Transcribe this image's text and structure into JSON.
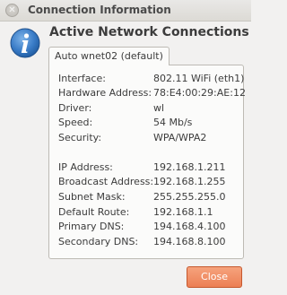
{
  "window": {
    "title": "Connection Information"
  },
  "heading": "Active Network Connections",
  "tab": {
    "label": "Auto wnet02 (default)"
  },
  "details": {
    "interface": {
      "label": "Interface:",
      "value": "802.11 WiFi (eth1)"
    },
    "hardware_address": {
      "label": "Hardware Address:",
      "value": "78:E4:00:29:AE:12"
    },
    "driver": {
      "label": "Driver:",
      "value": "wl"
    },
    "speed": {
      "label": "Speed:",
      "value": "54 Mb/s"
    },
    "security": {
      "label": "Security:",
      "value": "WPA/WPA2"
    },
    "ip_address": {
      "label": "IP Address:",
      "value": "192.168.1.211"
    },
    "broadcast_address": {
      "label": "Broadcast Address:",
      "value": "192.168.1.255"
    },
    "subnet_mask": {
      "label": "Subnet Mask:",
      "value": "255.255.255.0"
    },
    "default_route": {
      "label": "Default Route:",
      "value": "192.168.1.1"
    },
    "primary_dns": {
      "label": "Primary DNS:",
      "value": "194.168.4.100"
    },
    "secondary_dns": {
      "label": "Secondary DNS:",
      "value": "194.168.8.100"
    }
  },
  "buttons": {
    "close_label": "Close"
  },
  "icons": {
    "window_close": "close-icon",
    "info": "info-icon"
  },
  "colors": {
    "accent": "#ec7f54",
    "info_blue": "#2e6fb5"
  }
}
